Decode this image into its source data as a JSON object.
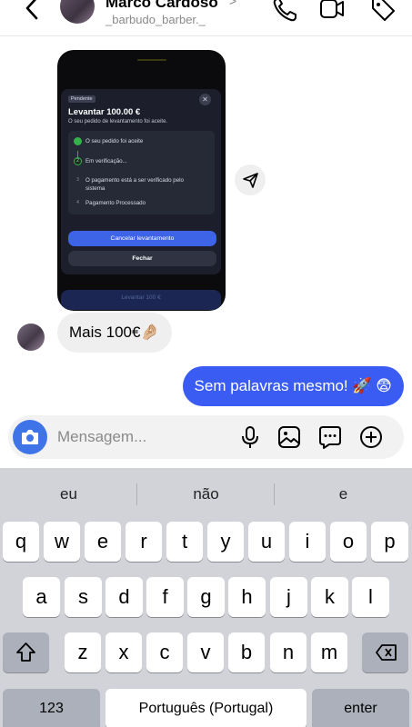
{
  "header": {
    "name": "Marco Cardoso",
    "handle": "_barbudo_barber._",
    "chevron": ">"
  },
  "shared_image": {
    "badge": "Pendente",
    "close": "✕",
    "title": "Levantar 100.00 €",
    "subtitle": "O seu pedido de levantamento foi aceite.",
    "steps": [
      {
        "marker": "",
        "text": "O seu pedido foi aceite"
      },
      {
        "marker": "2",
        "text": "Em verificação..."
      },
      {
        "marker": "3",
        "text": "O pagamento está a ser verificado pelo"
      },
      {
        "marker": "",
        "text": "sistema"
      },
      {
        "marker": "4",
        "text": "Pagamento Processado"
      }
    ],
    "cancel_button": "Cancelar levantamento",
    "close_button": "Fechar",
    "under_button": "Levantar 100 €"
  },
  "messages": {
    "incoming": "Mais 100€🤌🏼",
    "outgoing": "Sem palavras mesmo! 🚀 😨"
  },
  "composer": {
    "placeholder": "Mensagem..."
  },
  "keyboard": {
    "suggestions": [
      "eu",
      "não",
      "e"
    ],
    "row1": [
      "q",
      "w",
      "e",
      "r",
      "t",
      "y",
      "u",
      "i",
      "o",
      "p"
    ],
    "row2": [
      "a",
      "s",
      "d",
      "f",
      "g",
      "h",
      "j",
      "k",
      "l"
    ],
    "row3": [
      "z",
      "x",
      "c",
      "v",
      "b",
      "n",
      "m"
    ],
    "numbers_key": "123",
    "space_key": "Português (Portugal)",
    "enter_key": "enter"
  },
  "colors": {
    "accent": "#3a5cf3",
    "camera": "#3f74e9",
    "success": "#33b24a"
  }
}
